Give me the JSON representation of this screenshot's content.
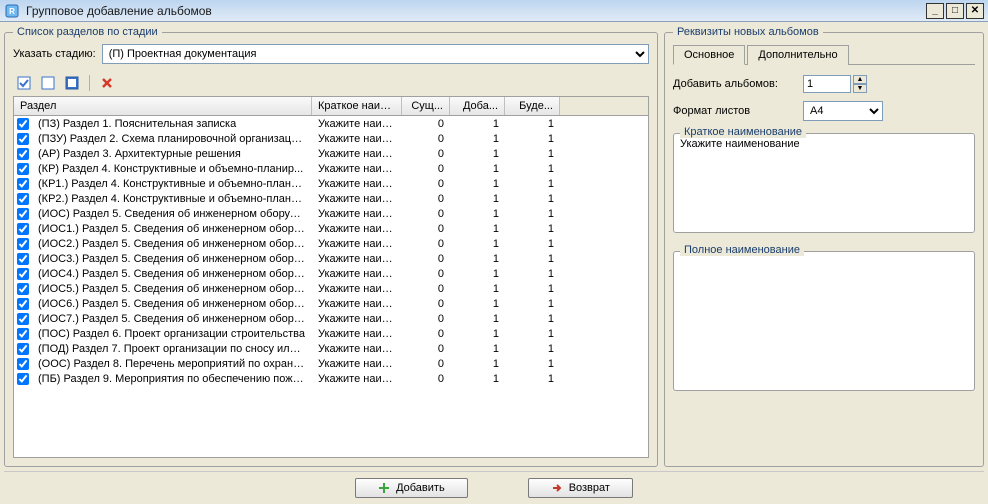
{
  "window": {
    "title": "Групповое добавление альбомов"
  },
  "left": {
    "legend": "Список разделов по стадии",
    "stage_label": "Указать стадию:",
    "stage_value": "(П) Проектная документация",
    "columns": {
      "c1": "Раздел",
      "c2": "Краткое наиме...",
      "c3": "Сущ...",
      "c4": "Доба...",
      "c5": "Буде..."
    }
  },
  "rows": [
    {
      "label": "(ПЗ) Раздел 1. Пояснительная записка",
      "short": "Укажите наим...",
      "exist": 0,
      "add": 1,
      "will": 1
    },
    {
      "label": "(ПЗУ) Раздел 2. Схема планировочной организации ...",
      "short": "Укажите наим...",
      "exist": 0,
      "add": 1,
      "will": 1
    },
    {
      "label": "(АР) Раздел 3. Архитектурные решения",
      "short": "Укажите наим...",
      "exist": 0,
      "add": 1,
      "will": 1
    },
    {
      "label": "(КР) Раздел 4. Конструктивные и объемно-планир...",
      "short": "Укажите наим...",
      "exist": 0,
      "add": 1,
      "will": 1
    },
    {
      "label": "(КР1.) Раздел 4. Конструктивные и объемно-плани...",
      "short": "Укажите наим...",
      "exist": 0,
      "add": 1,
      "will": 1
    },
    {
      "label": "(КР2.) Раздел 4. Конструктивные и объемно-плани...",
      "short": "Укажите наим...",
      "exist": 0,
      "add": 1,
      "will": 1
    },
    {
      "label": "(ИОС) Раздел 5. Сведения об инженерном оборудо...",
      "short": "Укажите наим...",
      "exist": 0,
      "add": 1,
      "will": 1
    },
    {
      "label": "(ИОС1.) Раздел 5. Сведения об инженерном обору...",
      "short": "Укажите наим...",
      "exist": 0,
      "add": 1,
      "will": 1
    },
    {
      "label": "(ИОС2.) Раздел 5. Сведения об инженерном обору...",
      "short": "Укажите наим...",
      "exist": 0,
      "add": 1,
      "will": 1
    },
    {
      "label": "(ИОС3.) Раздел 5. Сведения об инженерном обору...",
      "short": "Укажите наим...",
      "exist": 0,
      "add": 1,
      "will": 1
    },
    {
      "label": "(ИОС4.) Раздел 5. Сведения об инженерном обору...",
      "short": "Укажите наим...",
      "exist": 0,
      "add": 1,
      "will": 1
    },
    {
      "label": "(ИОС5.) Раздел 5. Сведения об инженерном обору...",
      "short": "Укажите наим...",
      "exist": 0,
      "add": 1,
      "will": 1
    },
    {
      "label": "(ИОС6.) Раздел 5. Сведения об инженерном обору...",
      "short": "Укажите наим...",
      "exist": 0,
      "add": 1,
      "will": 1
    },
    {
      "label": "(ИОС7.) Раздел 5. Сведения об инженерном обору...",
      "short": "Укажите наим...",
      "exist": 0,
      "add": 1,
      "will": 1
    },
    {
      "label": "(ПОС) Раздел 6. Проект организации строительства",
      "short": "Укажите наим...",
      "exist": 0,
      "add": 1,
      "will": 1
    },
    {
      "label": "(ПОД) Раздел 7. Проект организации по сносу или ...",
      "short": "Укажите наим...",
      "exist": 0,
      "add": 1,
      "will": 1
    },
    {
      "label": "(ООС) Раздел 8. Перечень мероприятий по охране ...",
      "short": "Укажите наим...",
      "exist": 0,
      "add": 1,
      "will": 1
    },
    {
      "label": "(ПБ) Раздел 9. Мероприятия по обеспечению пожа...",
      "short": "Укажите наим...",
      "exist": 0,
      "add": 1,
      "will": 1
    }
  ],
  "right": {
    "legend": "Реквизиты новых альбомов",
    "tabs": {
      "main": "Основное",
      "extra": "Дополнительно"
    },
    "add_label": "Добавить альбомов:",
    "add_value": "1",
    "format_label": "Формат листов",
    "format_value": "А4",
    "short_group": "Краткое наименование",
    "short_value": "Укажите наименование",
    "full_group": "Полное наименование",
    "full_value": ""
  },
  "footer": {
    "add": "Добавить",
    "back": "Возврат"
  }
}
